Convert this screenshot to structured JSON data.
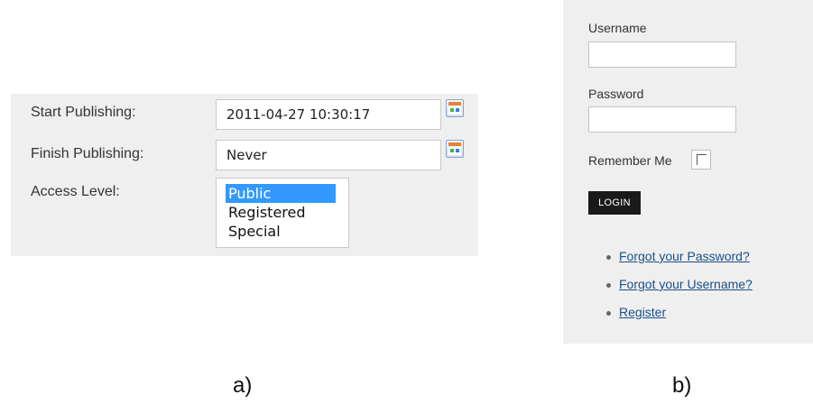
{
  "panel_a": {
    "start_publishing": {
      "label": "Start Publishing:",
      "value": "2011-04-27 10:30:17"
    },
    "finish_publishing": {
      "label": "Finish Publishing:",
      "value": "Never"
    },
    "access_level": {
      "label": "Access Level:",
      "options": [
        "Public",
        "Registered",
        "Special"
      ],
      "selected": "Public"
    }
  },
  "panel_b": {
    "username_label": "Username",
    "username_value": "",
    "password_label": "Password",
    "password_value": "",
    "remember_label": "Remember Me",
    "remember_checked": false,
    "login_label": "LOGIN",
    "links": [
      "Forgot your Password?",
      "Forgot your Username?",
      "Register"
    ]
  },
  "captions": {
    "a": "a)",
    "b": "b)"
  },
  "colors": {
    "panel_bg": "#efefef",
    "selection": "#3399ff",
    "link": "#1a4f8a",
    "button": "#1a1a1a"
  },
  "icons": {
    "date_picker": "calendar-icon"
  }
}
